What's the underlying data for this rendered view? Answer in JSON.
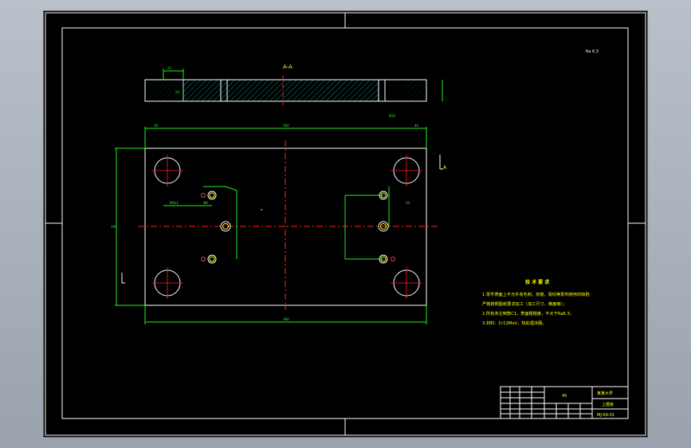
{
  "view_label_top": "A-A",
  "view_label_right": "A",
  "roughness_note": "Ra 6.3",
  "dims": {
    "overall_length": "380",
    "top_width": "360",
    "left_offset": "40",
    "right_offset": "40",
    "height": "190",
    "thread": "M6x1",
    "hole_dia": "Φ8",
    "pitch": "50",
    "section_thk": "25",
    "pin": "Φ10"
  },
  "tech_req": {
    "title": "技 术 要 求",
    "lines": [
      "1.零件表面上不允许有毛刺、划痕、裂纹等影响使用的缺陷",
      "严格按照图纸要求加工（加工尺寸、精度等）；",
      "2.所有未注倒角C1，表面粗糙度，不大于Ra6.3；",
      "3.材料：Cr12MoV，热处理淬硬。"
    ]
  },
  "title_block": {
    "school": "某某大学",
    "part_name": "上模板",
    "drawing_no": "MJ-09-01",
    "material": "45"
  },
  "colors": {
    "frame": "#ffffff",
    "dimension": "#22ee22",
    "centerline": "#ff2020",
    "hatch": "#00cccc",
    "label": "#ffff00"
  }
}
